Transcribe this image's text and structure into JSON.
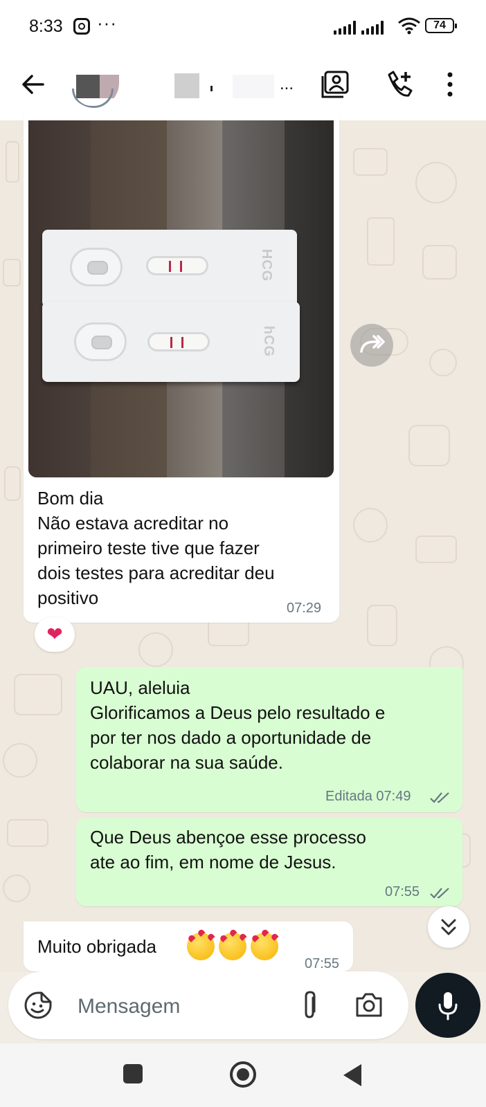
{
  "status_bar": {
    "time": "8:33",
    "dots": "···",
    "battery": "74"
  },
  "header": {
    "name_suffix": "..."
  },
  "messages": {
    "photo_caption": "Bom dia\nNão estava acreditar no\nprimeiro teste tive que fazer\ndois testes para acreditar deu\npositivo",
    "photo_time": "07:29",
    "photo_reaction": "❤",
    "reply1_text": "UAU, aleluia\nGlorificamos a Deus pelo resultado e\npor ter nos dado a oportunidade de\ncolaborar na sua saúde.",
    "reply1_meta": "Editada 07:49",
    "reply2_text": "Que Deus abençoe esse processo\nate ao fim, em nome de Jesus.",
    "reply2_time": "07:55",
    "last_text": "Muito obrigada",
    "last_time": "07:55"
  },
  "composer": {
    "placeholder": "Mensagem"
  },
  "colors": {
    "outgoing_bubble": "#d8fdd2",
    "incoming_bubble": "#ffffff",
    "read_ticks": "#667781",
    "mic_button": "#111b21"
  },
  "icons": [
    "instagram-icon",
    "wifi-icon",
    "back-arrow-icon",
    "contact-card-icon",
    "add-call-icon",
    "more-vert-icon",
    "forward-icon",
    "chevrons-down-icon",
    "sticker-icon",
    "paperclip-icon",
    "camera-icon",
    "mic-icon"
  ]
}
